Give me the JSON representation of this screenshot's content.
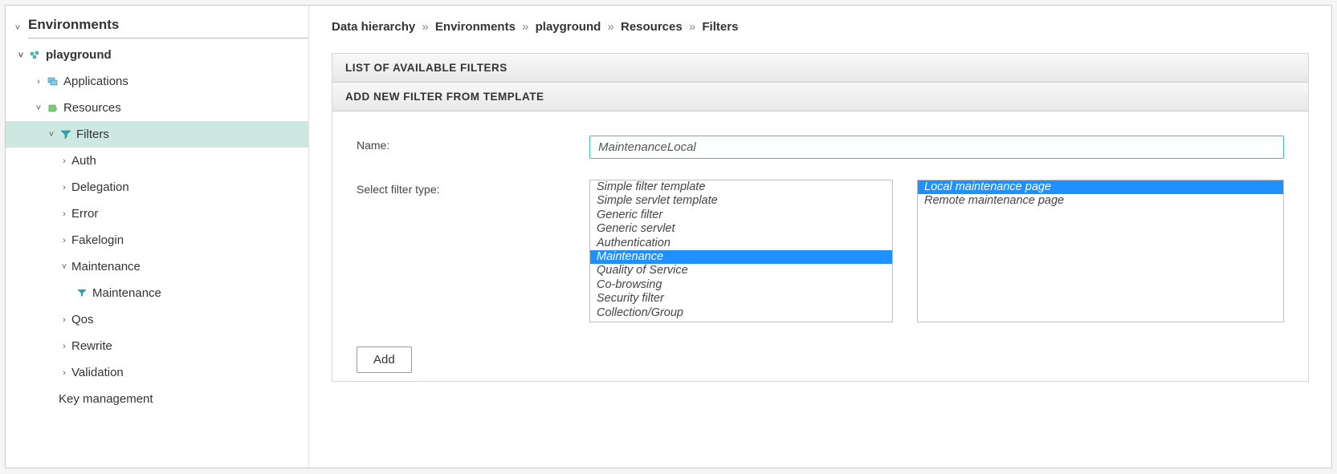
{
  "sidebar": {
    "title": "Environments",
    "root": {
      "label": "playground"
    },
    "items": [
      {
        "label": "Applications"
      },
      {
        "label": "Resources"
      },
      {
        "label": "Filters"
      },
      {
        "label": "Auth"
      },
      {
        "label": "Delegation"
      },
      {
        "label": "Error"
      },
      {
        "label": "Fakelogin"
      },
      {
        "label": "Maintenance"
      },
      {
        "label": "Maintenance"
      },
      {
        "label": "Qos"
      },
      {
        "label": "Rewrite"
      },
      {
        "label": "Validation"
      },
      {
        "label": "Key management"
      }
    ]
  },
  "breadcrumb": {
    "parts": [
      "Data hierarchy",
      "Environments",
      "playground",
      "Resources",
      "Filters"
    ]
  },
  "panels": {
    "list_title": "LIST OF AVAILABLE FILTERS",
    "add_title": "ADD NEW FILTER FROM TEMPLATE"
  },
  "form": {
    "name_label": "Name:",
    "name_value": "MaintenanceLocal",
    "type_label": "Select filter type:",
    "filter_types": [
      "Simple filter template",
      "Simple servlet template",
      "Generic filter",
      "Generic servlet",
      "Authentication",
      "Maintenance",
      "Quality of Service",
      "Co-browsing",
      "Security filter",
      "Collection/Group"
    ],
    "filter_type_selected_index": 5,
    "sub_options": [
      "Local maintenance page",
      "Remote maintenance page"
    ],
    "sub_selected_index": 0,
    "add_button": "Add"
  }
}
